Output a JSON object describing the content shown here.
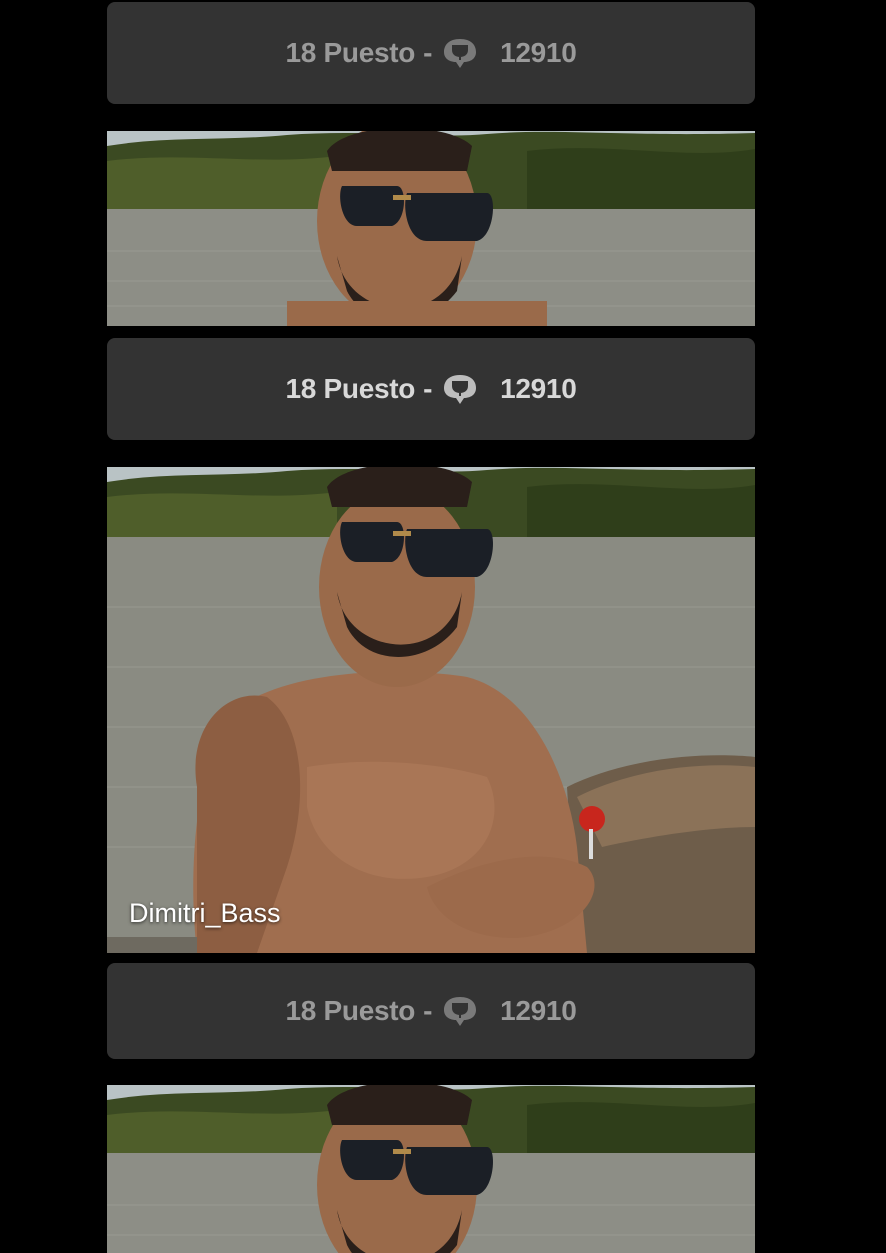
{
  "cards": [
    {
      "rank_label": "18 Puesto",
      "separator": "-",
      "score": "12910",
      "icon": "trophy-chat-icon"
    },
    {
      "rank_label": "18 Puesto",
      "separator": "-",
      "score": "12910",
      "icon": "trophy-chat-icon"
    },
    {
      "rank_label": "18 Puesto",
      "separator": "-",
      "score": "12910",
      "icon": "trophy-chat-icon"
    }
  ],
  "featured": {
    "model_name": "Dimitri_Bass"
  },
  "colors": {
    "background": "#000000",
    "bar": "#333333",
    "bar_text": "#9a9a9a"
  }
}
